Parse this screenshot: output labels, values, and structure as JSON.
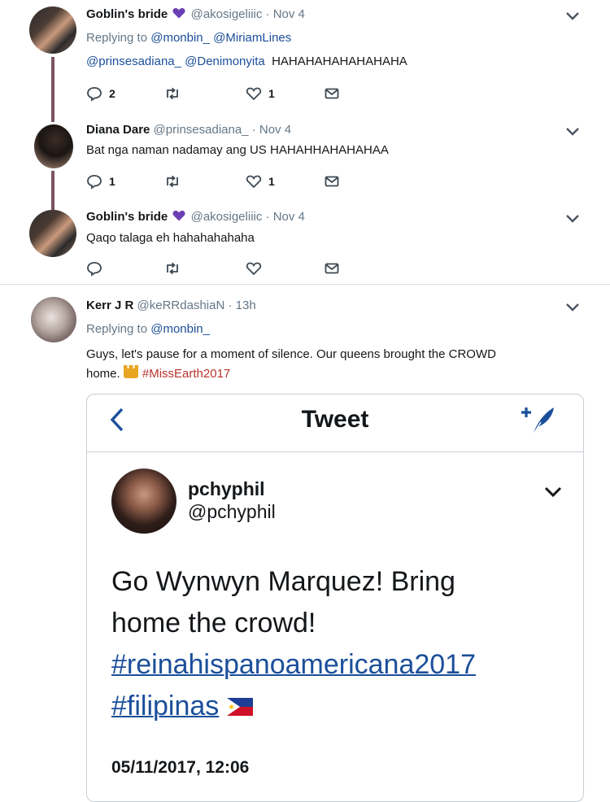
{
  "colors": {
    "accent": "#1b4f9a",
    "muted": "#657786",
    "thread": "#7b5560",
    "hashtag": "#b8342d"
  },
  "tweets": [
    {
      "name": "Goblin's bride",
      "handle": "@akosigeliiic",
      "sep": " · ",
      "time": "Nov 4",
      "reply_prefix": "Replying to ",
      "reply_to": [
        "@monbin_",
        "@MiriamLines"
      ],
      "mentions": [
        "@prinsesadiana_",
        "@Denimonyita"
      ],
      "text": "HAHAHAHAHAHAHAHA",
      "reply_count": "2",
      "like_count": "1"
    },
    {
      "name": "Diana Dare",
      "handle": "@prinsesadiana_",
      "sep": " · ",
      "time": "Nov 4",
      "text": "Bat nga naman nadamay ang US HAHAHHAHAHAHAA",
      "reply_count": "1",
      "like_count": "1"
    },
    {
      "name": "Goblin's bride",
      "handle": "@akosigeliiic",
      "sep": " · ",
      "time": "Nov 4",
      "text": "Qaqo talaga eh hahahahahaha"
    },
    {
      "name": "Kerr J R",
      "handle": "@keRRdashiaN",
      "sep": " · ",
      "time": "13h",
      "reply_prefix": "Replying to ",
      "reply_to": [
        "@monbin_"
      ],
      "text_line1": "Guys, let's pause for a moment of silence. Our queens brought the CROWD",
      "text_line2": "home.",
      "hashtag": "#MissEarth2017"
    }
  ],
  "embedded": {
    "header_title": "Tweet",
    "author_name": "pchyphil",
    "author_handle": "@pchyphil",
    "text_line1": "Go Wynwyn Marquez! Bring",
    "text_line2": "home the crowd!",
    "hashtag1": "#reinahispanoamericana2017",
    "hashtag2": "#filipinas",
    "date": "05/11/2017, 12:06"
  }
}
